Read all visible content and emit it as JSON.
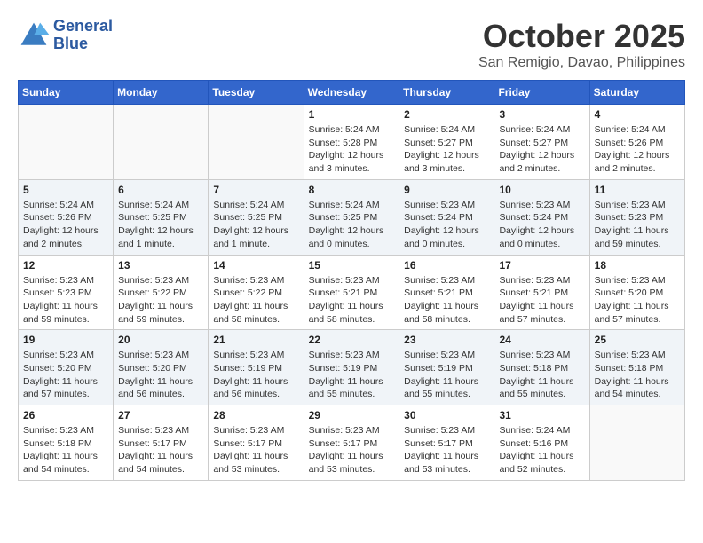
{
  "header": {
    "logo_line1": "General",
    "logo_line2": "Blue",
    "month": "October 2025",
    "location": "San Remigio, Davao, Philippines"
  },
  "weekdays": [
    "Sunday",
    "Monday",
    "Tuesday",
    "Wednesday",
    "Thursday",
    "Friday",
    "Saturday"
  ],
  "weeks": [
    [
      {
        "day": "",
        "sunrise": "",
        "sunset": "",
        "daylight": ""
      },
      {
        "day": "",
        "sunrise": "",
        "sunset": "",
        "daylight": ""
      },
      {
        "day": "",
        "sunrise": "",
        "sunset": "",
        "daylight": ""
      },
      {
        "day": "1",
        "sunrise": "Sunrise: 5:24 AM",
        "sunset": "Sunset: 5:28 PM",
        "daylight": "Daylight: 12 hours and 3 minutes."
      },
      {
        "day": "2",
        "sunrise": "Sunrise: 5:24 AM",
        "sunset": "Sunset: 5:27 PM",
        "daylight": "Daylight: 12 hours and 3 minutes."
      },
      {
        "day": "3",
        "sunrise": "Sunrise: 5:24 AM",
        "sunset": "Sunset: 5:27 PM",
        "daylight": "Daylight: 12 hours and 2 minutes."
      },
      {
        "day": "4",
        "sunrise": "Sunrise: 5:24 AM",
        "sunset": "Sunset: 5:26 PM",
        "daylight": "Daylight: 12 hours and 2 minutes."
      }
    ],
    [
      {
        "day": "5",
        "sunrise": "Sunrise: 5:24 AM",
        "sunset": "Sunset: 5:26 PM",
        "daylight": "Daylight: 12 hours and 2 minutes."
      },
      {
        "day": "6",
        "sunrise": "Sunrise: 5:24 AM",
        "sunset": "Sunset: 5:25 PM",
        "daylight": "Daylight: 12 hours and 1 minute."
      },
      {
        "day": "7",
        "sunrise": "Sunrise: 5:24 AM",
        "sunset": "Sunset: 5:25 PM",
        "daylight": "Daylight: 12 hours and 1 minute."
      },
      {
        "day": "8",
        "sunrise": "Sunrise: 5:24 AM",
        "sunset": "Sunset: 5:25 PM",
        "daylight": "Daylight: 12 hours and 0 minutes."
      },
      {
        "day": "9",
        "sunrise": "Sunrise: 5:23 AM",
        "sunset": "Sunset: 5:24 PM",
        "daylight": "Daylight: 12 hours and 0 minutes."
      },
      {
        "day": "10",
        "sunrise": "Sunrise: 5:23 AM",
        "sunset": "Sunset: 5:24 PM",
        "daylight": "Daylight: 12 hours and 0 minutes."
      },
      {
        "day": "11",
        "sunrise": "Sunrise: 5:23 AM",
        "sunset": "Sunset: 5:23 PM",
        "daylight": "Daylight: 11 hours and 59 minutes."
      }
    ],
    [
      {
        "day": "12",
        "sunrise": "Sunrise: 5:23 AM",
        "sunset": "Sunset: 5:23 PM",
        "daylight": "Daylight: 11 hours and 59 minutes."
      },
      {
        "day": "13",
        "sunrise": "Sunrise: 5:23 AM",
        "sunset": "Sunset: 5:22 PM",
        "daylight": "Daylight: 11 hours and 59 minutes."
      },
      {
        "day": "14",
        "sunrise": "Sunrise: 5:23 AM",
        "sunset": "Sunset: 5:22 PM",
        "daylight": "Daylight: 11 hours and 58 minutes."
      },
      {
        "day": "15",
        "sunrise": "Sunrise: 5:23 AM",
        "sunset": "Sunset: 5:21 PM",
        "daylight": "Daylight: 11 hours and 58 minutes."
      },
      {
        "day": "16",
        "sunrise": "Sunrise: 5:23 AM",
        "sunset": "Sunset: 5:21 PM",
        "daylight": "Daylight: 11 hours and 58 minutes."
      },
      {
        "day": "17",
        "sunrise": "Sunrise: 5:23 AM",
        "sunset": "Sunset: 5:21 PM",
        "daylight": "Daylight: 11 hours and 57 minutes."
      },
      {
        "day": "18",
        "sunrise": "Sunrise: 5:23 AM",
        "sunset": "Sunset: 5:20 PM",
        "daylight": "Daylight: 11 hours and 57 minutes."
      }
    ],
    [
      {
        "day": "19",
        "sunrise": "Sunrise: 5:23 AM",
        "sunset": "Sunset: 5:20 PM",
        "daylight": "Daylight: 11 hours and 57 minutes."
      },
      {
        "day": "20",
        "sunrise": "Sunrise: 5:23 AM",
        "sunset": "Sunset: 5:20 PM",
        "daylight": "Daylight: 11 hours and 56 minutes."
      },
      {
        "day": "21",
        "sunrise": "Sunrise: 5:23 AM",
        "sunset": "Sunset: 5:19 PM",
        "daylight": "Daylight: 11 hours and 56 minutes."
      },
      {
        "day": "22",
        "sunrise": "Sunrise: 5:23 AM",
        "sunset": "Sunset: 5:19 PM",
        "daylight": "Daylight: 11 hours and 55 minutes."
      },
      {
        "day": "23",
        "sunrise": "Sunrise: 5:23 AM",
        "sunset": "Sunset: 5:19 PM",
        "daylight": "Daylight: 11 hours and 55 minutes."
      },
      {
        "day": "24",
        "sunrise": "Sunrise: 5:23 AM",
        "sunset": "Sunset: 5:18 PM",
        "daylight": "Daylight: 11 hours and 55 minutes."
      },
      {
        "day": "25",
        "sunrise": "Sunrise: 5:23 AM",
        "sunset": "Sunset: 5:18 PM",
        "daylight": "Daylight: 11 hours and 54 minutes."
      }
    ],
    [
      {
        "day": "26",
        "sunrise": "Sunrise: 5:23 AM",
        "sunset": "Sunset: 5:18 PM",
        "daylight": "Daylight: 11 hours and 54 minutes."
      },
      {
        "day": "27",
        "sunrise": "Sunrise: 5:23 AM",
        "sunset": "Sunset: 5:17 PM",
        "daylight": "Daylight: 11 hours and 54 minutes."
      },
      {
        "day": "28",
        "sunrise": "Sunrise: 5:23 AM",
        "sunset": "Sunset: 5:17 PM",
        "daylight": "Daylight: 11 hours and 53 minutes."
      },
      {
        "day": "29",
        "sunrise": "Sunrise: 5:23 AM",
        "sunset": "Sunset: 5:17 PM",
        "daylight": "Daylight: 11 hours and 53 minutes."
      },
      {
        "day": "30",
        "sunrise": "Sunrise: 5:23 AM",
        "sunset": "Sunset: 5:17 PM",
        "daylight": "Daylight: 11 hours and 53 minutes."
      },
      {
        "day": "31",
        "sunrise": "Sunrise: 5:24 AM",
        "sunset": "Sunset: 5:16 PM",
        "daylight": "Daylight: 11 hours and 52 minutes."
      },
      {
        "day": "",
        "sunrise": "",
        "sunset": "",
        "daylight": ""
      }
    ]
  ]
}
